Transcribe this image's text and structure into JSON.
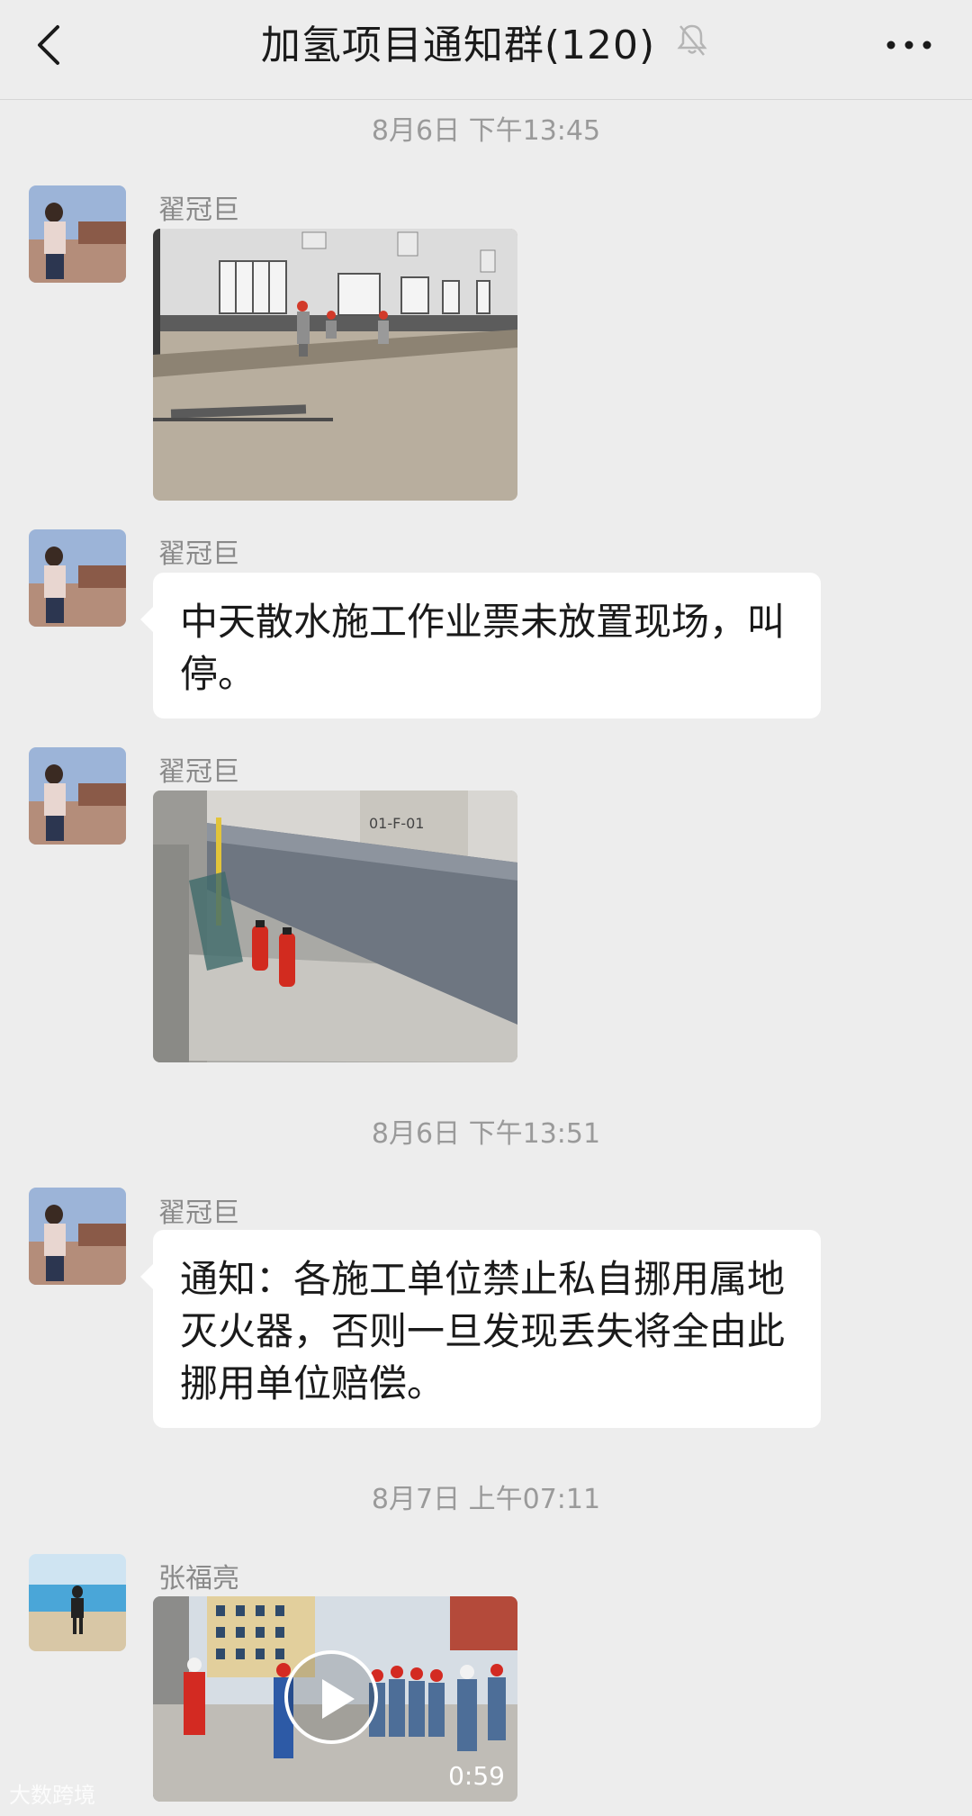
{
  "header": {
    "title": "加氢项目通知群(120)",
    "back_icon": "chevron-left-icon",
    "mute_icon": "bell-mute-icon",
    "more_icon": "more-dots-icon"
  },
  "messages": [
    {
      "type": "timestamp",
      "text": "8月6日 下午13:45"
    },
    {
      "type": "image",
      "sender": "翟冠巨"
    },
    {
      "type": "text",
      "sender": "翟冠巨",
      "text": "中天散水施工作业票未放置现场，叫停。"
    },
    {
      "type": "image",
      "sender": "翟冠巨",
      "image_label": "01-F-01"
    },
    {
      "type": "timestamp",
      "text": "8月6日 下午13:51"
    },
    {
      "type": "text",
      "sender": "翟冠巨",
      "text": "通知：各施工单位禁止私自挪用属地灭火器，否则一旦发现丢失将全由此挪用单位赔偿。"
    },
    {
      "type": "timestamp",
      "text": "8月7日 上午07:11"
    },
    {
      "type": "video",
      "sender": "张福亮",
      "duration": "0:59"
    }
  ],
  "watermark": "大数跨境",
  "colors": {
    "background": "#ededed",
    "bubble": "#ffffff",
    "timestamp": "#9a9a9a"
  }
}
